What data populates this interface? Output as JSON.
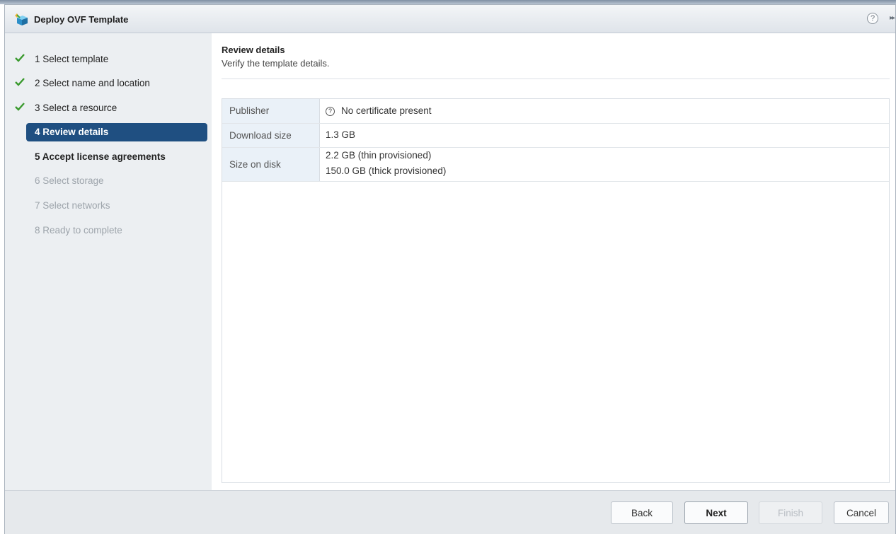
{
  "dialog": {
    "title": "Deploy OVF Template",
    "help_icon": "?",
    "expand_icon": "▸▸"
  },
  "steps": [
    {
      "label": "1  Select template",
      "state": "done"
    },
    {
      "label": "2  Select name and location",
      "state": "done"
    },
    {
      "label": "3  Select a resource",
      "state": "done"
    },
    {
      "label": "4  Review details",
      "state": "active"
    },
    {
      "label": "5  Accept license agreements",
      "state": "next"
    },
    {
      "label": "6  Select storage",
      "state": "future"
    },
    {
      "label": "7  Select networks",
      "state": "future"
    },
    {
      "label": "8  Ready to complete",
      "state": "future"
    }
  ],
  "content": {
    "title": "Review details",
    "subtitle": "Verify the template details."
  },
  "details": {
    "publisher": {
      "key": "Publisher",
      "value": "No certificate present",
      "icon": "?"
    },
    "download": {
      "key": "Download size",
      "value": "1.3 GB"
    },
    "disk": {
      "key": "Size on disk",
      "value_thin": "2.2 GB (thin provisioned)",
      "value_thick": "150.0 GB (thick provisioned)"
    }
  },
  "footer": {
    "back": "Back",
    "next": "Next",
    "finish": "Finish",
    "cancel": "Cancel"
  },
  "colors": {
    "active_step_bg": "#1f4f81",
    "check_green": "#3a9a2e"
  }
}
